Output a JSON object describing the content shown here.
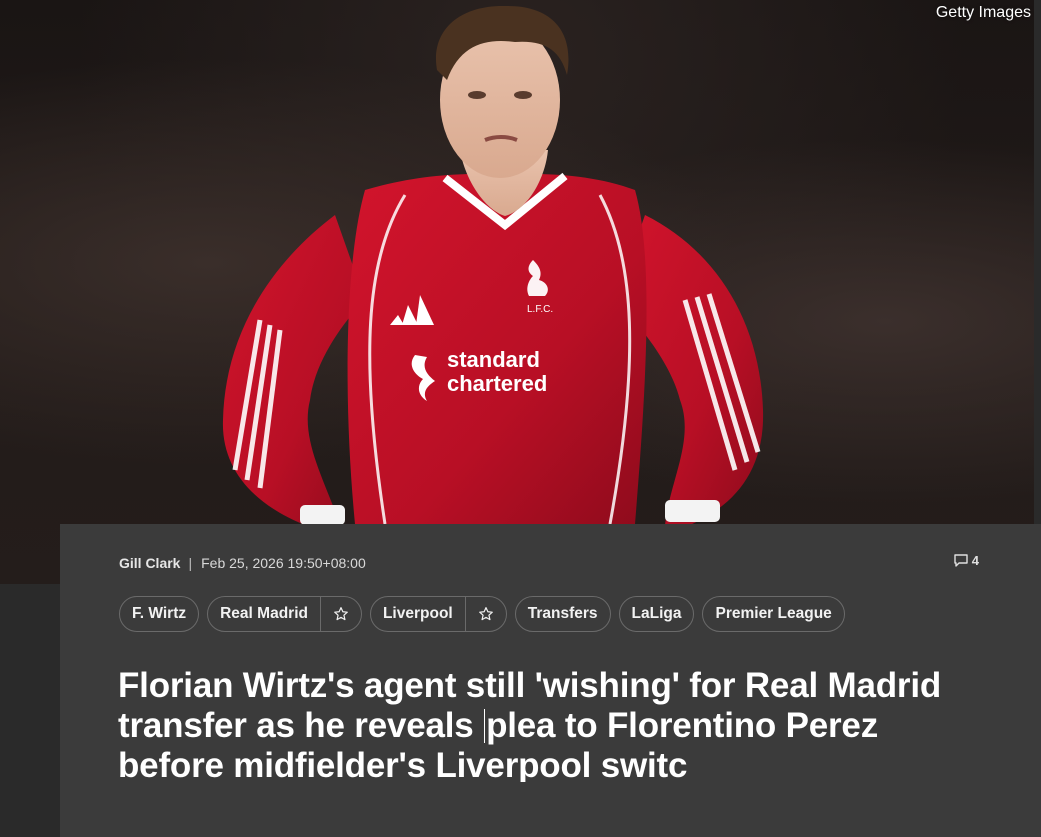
{
  "hero": {
    "credit": "Getty Images",
    "shirt_sponsor": [
      "standard",
      "chartered"
    ],
    "crest_text": "L.F.C."
  },
  "article": {
    "author": "Gill Clark",
    "separator": "|",
    "timestamp": "Feb 25, 2026 19:50+08:00",
    "comment_count": "4",
    "tags": [
      {
        "label": "F. Wirtz",
        "followable": false
      },
      {
        "label": "Real Madrid",
        "followable": true
      },
      {
        "label": "Liverpool",
        "followable": true
      },
      {
        "label": "Transfers",
        "followable": false
      },
      {
        "label": "LaLiga",
        "followable": false
      },
      {
        "label": "Premier League",
        "followable": false
      }
    ],
    "headline_part1": "Florian Wirtz's agent still 'wishing' for Real Madrid transfer as he reveals ",
    "headline_part2": "plea to Florentino Perez before midfielder's Liverpool switc"
  },
  "icons": {
    "comment": "comment-bubble-icon",
    "follow": "star-outline-icon"
  },
  "colors": {
    "card_background": "#3b3b3b",
    "page_background": "#2a2a2a",
    "tag_border": "#6a6a6a",
    "shirt_red": "#c8102e"
  }
}
